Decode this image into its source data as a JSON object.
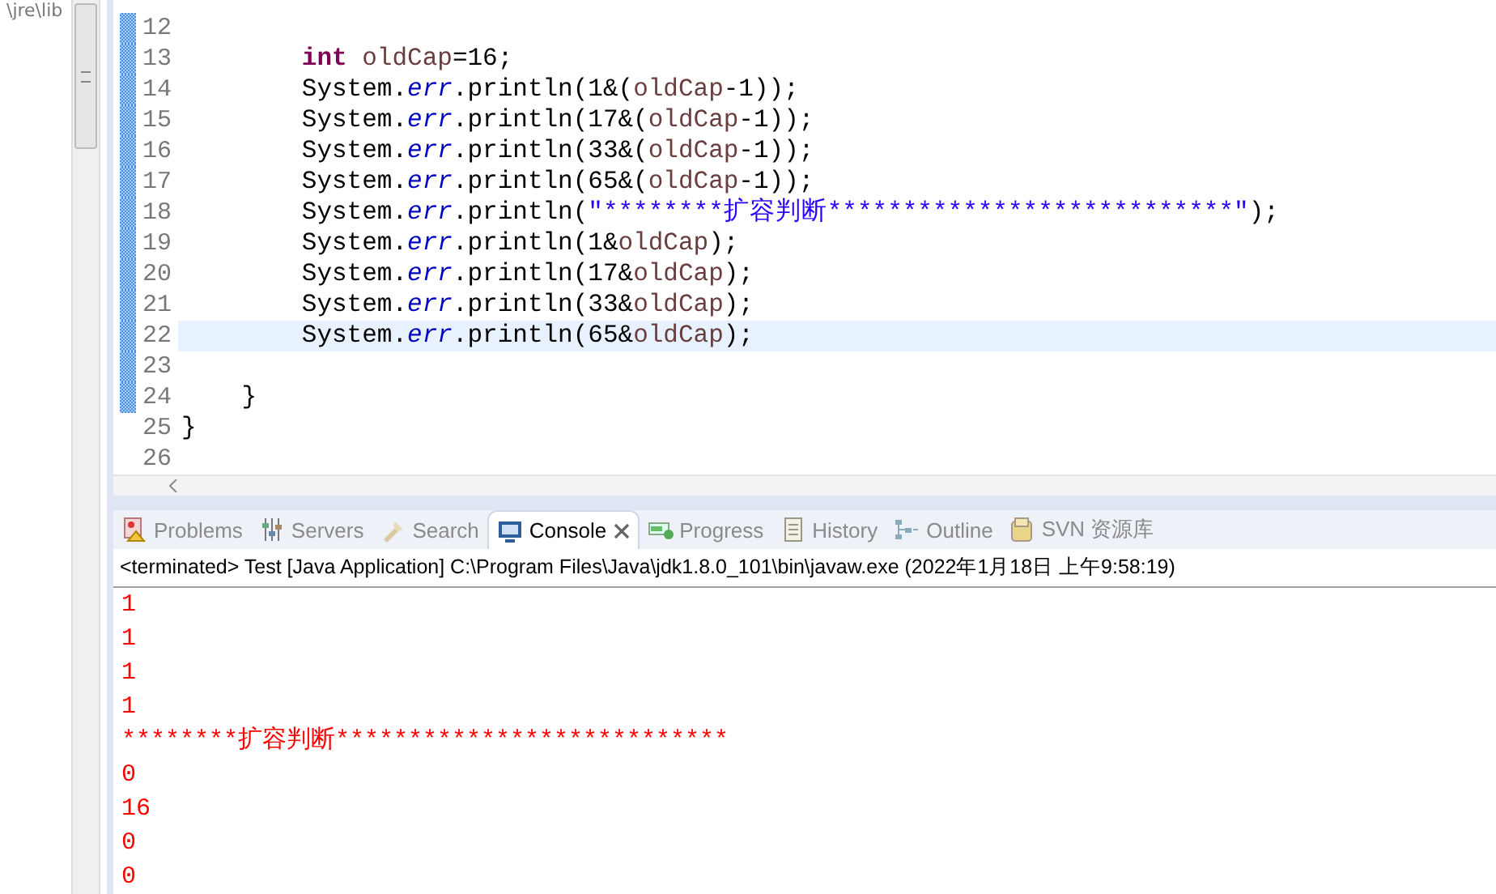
{
  "explorer": {
    "path": "\\jre\\lib"
  },
  "editor": {
    "lines": [
      {
        "number": "12",
        "changed": true,
        "current": false
      },
      {
        "number": "13",
        "changed": true,
        "current": false,
        "kind": "statement",
        "tokens": [
          {
            "kind": "keyword",
            "text": "int"
          },
          {
            "kind": "var",
            "text": " oldCap"
          },
          {
            "kind": "plain",
            "text": "=16;"
          }
        ]
      },
      {
        "number": "14",
        "changed": true,
        "current": false,
        "kind": "statement",
        "tokens": [
          {
            "kind": "plain",
            "text": "System."
          },
          {
            "kind": "field",
            "text": "err"
          },
          {
            "kind": "plain",
            "text": ".println(1&("
          },
          {
            "kind": "var",
            "text": "oldCap"
          },
          {
            "kind": "plain",
            "text": "-1));"
          }
        ]
      },
      {
        "number": "15",
        "changed": true,
        "current": false,
        "kind": "statement",
        "tokens": [
          {
            "kind": "plain",
            "text": "System."
          },
          {
            "kind": "field",
            "text": "err"
          },
          {
            "kind": "plain",
            "text": ".println(17&("
          },
          {
            "kind": "var",
            "text": "oldCap"
          },
          {
            "kind": "plain",
            "text": "-1));"
          }
        ]
      },
      {
        "number": "16",
        "changed": true,
        "current": false,
        "kind": "statement",
        "tokens": [
          {
            "kind": "plain",
            "text": "System."
          },
          {
            "kind": "field",
            "text": "err"
          },
          {
            "kind": "plain",
            "text": ".println(33&("
          },
          {
            "kind": "var",
            "text": "oldCap"
          },
          {
            "kind": "plain",
            "text": "-1));"
          }
        ]
      },
      {
        "number": "17",
        "changed": true,
        "current": false,
        "kind": "statement",
        "tokens": [
          {
            "kind": "plain",
            "text": "System."
          },
          {
            "kind": "field",
            "text": "err"
          },
          {
            "kind": "plain",
            "text": ".println(65&("
          },
          {
            "kind": "var",
            "text": "oldCap"
          },
          {
            "kind": "plain",
            "text": "-1));"
          }
        ]
      },
      {
        "number": "18",
        "changed": true,
        "current": false,
        "kind": "statement",
        "tokens": [
          {
            "kind": "plain",
            "text": "System."
          },
          {
            "kind": "field",
            "text": "err"
          },
          {
            "kind": "plain",
            "text": ".println("
          },
          {
            "kind": "string",
            "text": "\"********扩容判断***************************\""
          },
          {
            "kind": "plain",
            "text": ");"
          }
        ]
      },
      {
        "number": "19",
        "changed": true,
        "current": false,
        "kind": "statement",
        "tokens": [
          {
            "kind": "plain",
            "text": "System."
          },
          {
            "kind": "field",
            "text": "err"
          },
          {
            "kind": "plain",
            "text": ".println(1&"
          },
          {
            "kind": "var",
            "text": "oldCap"
          },
          {
            "kind": "plain",
            "text": ");"
          }
        ]
      },
      {
        "number": "20",
        "changed": true,
        "current": false,
        "kind": "statement",
        "tokens": [
          {
            "kind": "plain",
            "text": "System."
          },
          {
            "kind": "field",
            "text": "err"
          },
          {
            "kind": "plain",
            "text": ".println(17&"
          },
          {
            "kind": "var",
            "text": "oldCap"
          },
          {
            "kind": "plain",
            "text": ");"
          }
        ]
      },
      {
        "number": "21",
        "changed": true,
        "current": false,
        "kind": "statement",
        "tokens": [
          {
            "kind": "plain",
            "text": "System."
          },
          {
            "kind": "field",
            "text": "err"
          },
          {
            "kind": "plain",
            "text": ".println(33&"
          },
          {
            "kind": "var",
            "text": "oldCap"
          },
          {
            "kind": "plain",
            "text": ");"
          }
        ]
      },
      {
        "number": "22",
        "changed": true,
        "current": true,
        "kind": "statement",
        "tokens": [
          {
            "kind": "plain",
            "text": "System."
          },
          {
            "kind": "field",
            "text": "err"
          },
          {
            "kind": "plain",
            "text": ".println(65&"
          },
          {
            "kind": "var",
            "text": "oldCap"
          },
          {
            "kind": "plain",
            "text": ");"
          }
        ]
      },
      {
        "number": "23",
        "changed": true,
        "current": false
      },
      {
        "number": "24",
        "changed": true,
        "current": false,
        "kind": "method-close",
        "tokens": [
          {
            "kind": "plain",
            "text": "}"
          }
        ]
      },
      {
        "number": "25",
        "changed": false,
        "current": false,
        "kind": "class-close",
        "tokens": [
          {
            "kind": "plain",
            "text": "}"
          }
        ]
      },
      {
        "number": "26",
        "changed": false,
        "current": false
      }
    ]
  },
  "tabs": [
    {
      "label": "Problems",
      "kind": "problems",
      "selected": false
    },
    {
      "label": "Servers",
      "kind": "servers",
      "selected": false
    },
    {
      "label": "Search",
      "kind": "search",
      "selected": false
    },
    {
      "label": "Console",
      "kind": "console",
      "selected": true
    },
    {
      "label": "Progress",
      "kind": "progress",
      "selected": false
    },
    {
      "label": "History",
      "kind": "history",
      "selected": false
    },
    {
      "label": "Outline",
      "kind": "outline",
      "selected": false
    },
    {
      "label": "SVN 资源库",
      "kind": "svn",
      "selected": false
    }
  ],
  "console": {
    "header": "<terminated> Test [Java Application] C:\\Program Files\\Java\\jdk1.8.0_101\\bin\\javaw.exe (2022年1月18日 上午9:58:19)",
    "output": [
      "1",
      "1",
      "1",
      "1",
      "********扩容判断***************************",
      "0",
      "16",
      "0",
      "0"
    ]
  }
}
